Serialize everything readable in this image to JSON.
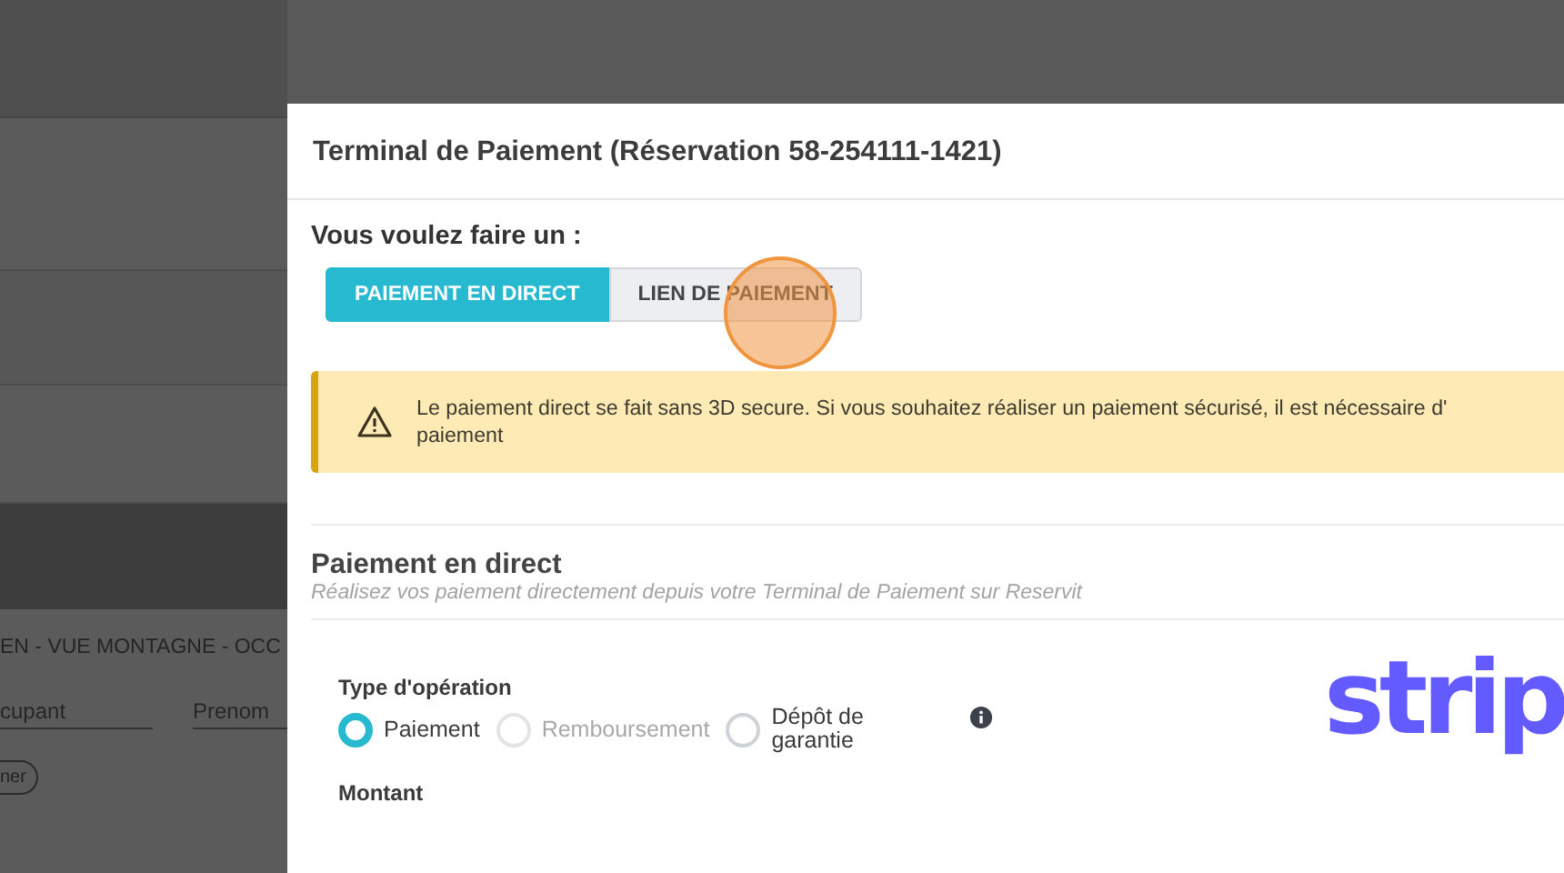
{
  "background": {
    "room_label": "EN - VUE MONTAGNE - OCC",
    "fields": [
      {
        "placeholder": "cupant"
      },
      {
        "placeholder": "Prenom"
      }
    ],
    "button": "ner"
  },
  "modal": {
    "title": "Terminal de Paiement (Réservation 58-254111-1421)",
    "choice_label": "Vous voulez faire un :",
    "modes": [
      {
        "label": "PAIEMENT EN DIRECT",
        "selected": true
      },
      {
        "label": "LIEN DE PAIEMENT",
        "selected": false
      }
    ],
    "alert": "Le paiement direct se fait sans 3D secure. Si vous souhaitez réaliser un paiement sécurisé, il est nécessaire d'\npaiement",
    "section_title": "Paiement en direct",
    "section_subtitle": "Réalisez vos paiement directement depuis votre Terminal de Paiement sur Reservit",
    "operation_label": "Type d'opération",
    "operations": [
      {
        "label": "Paiement",
        "selected": true,
        "disabled": false
      },
      {
        "label": "Remboursement",
        "selected": false,
        "disabled": true
      },
      {
        "label": "Dépôt de garantie",
        "selected": false,
        "disabled": false
      }
    ],
    "amount_label": "Montant",
    "logo": "strip"
  }
}
